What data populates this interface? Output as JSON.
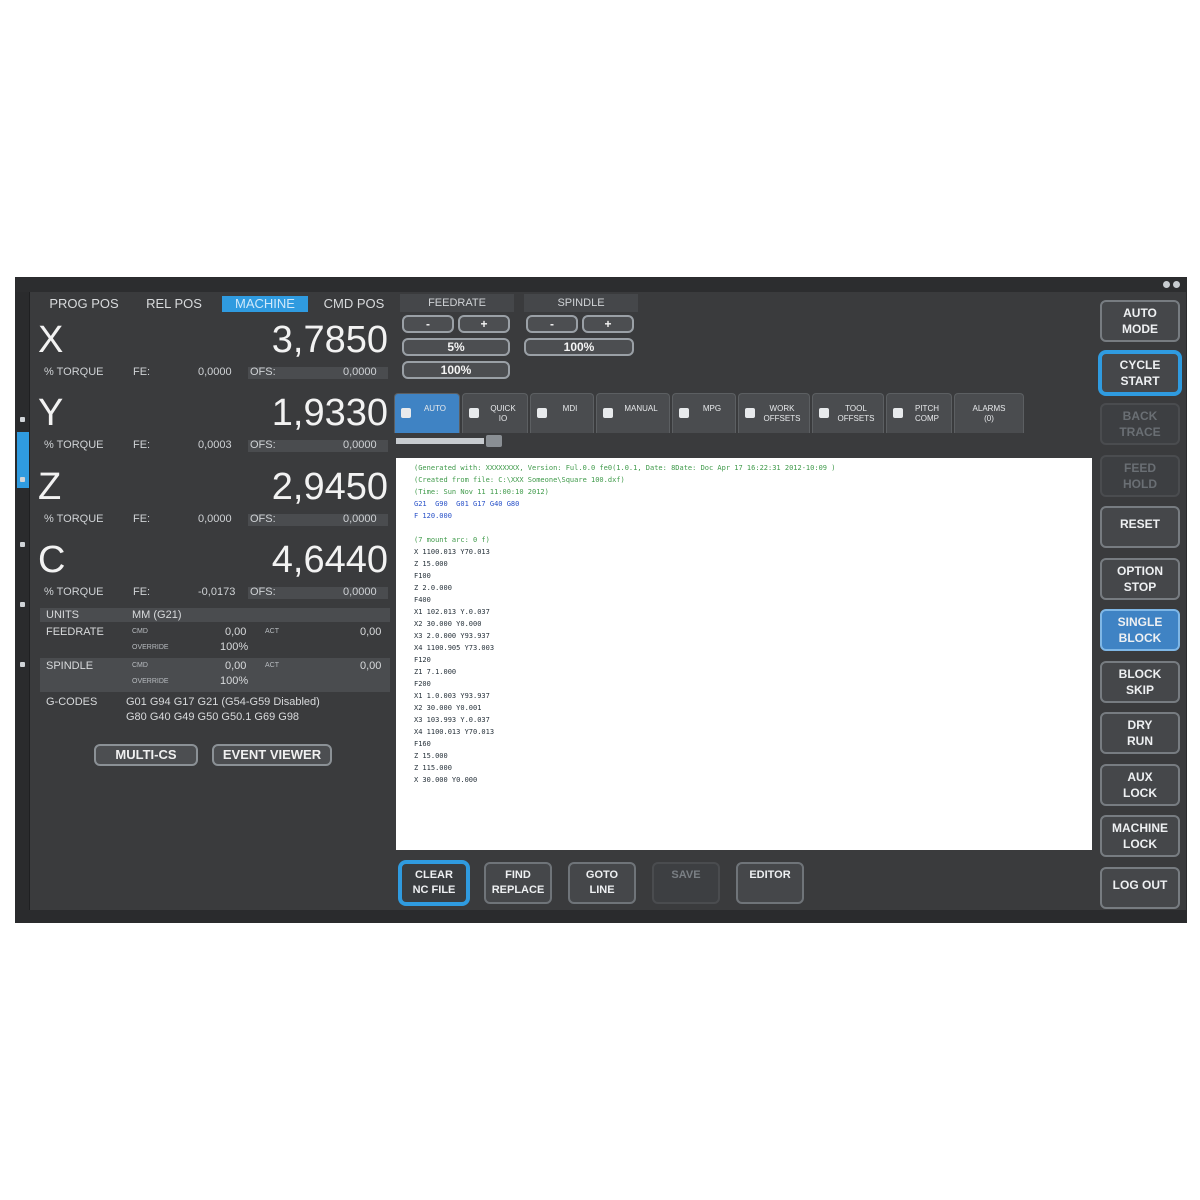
{
  "position": {
    "tabs": [
      "PROG POS",
      "REL POS",
      "MACHINE",
      "CMD POS"
    ],
    "active_tab": 2,
    "axes": [
      {
        "letter": "X",
        "value": "3,7850",
        "torque_label": "% TORQUE",
        "fe_label": "FE:",
        "fe_value": "0,0000",
        "ofs_label": "OFS:",
        "ofs_value": "0,0000"
      },
      {
        "letter": "Y",
        "value": "1,9330",
        "torque_label": "% TORQUE",
        "fe_label": "FE:",
        "fe_value": "0,0003",
        "ofs_label": "OFS:",
        "ofs_value": "0,0000"
      },
      {
        "letter": "Z",
        "value": "2,9450",
        "torque_label": "% TORQUE",
        "fe_label": "FE:",
        "fe_value": "0,0000",
        "ofs_label": "OFS:",
        "ofs_value": "0,0000"
      },
      {
        "letter": "C",
        "value": "4,6440",
        "torque_label": "% TORQUE",
        "fe_label": "FE:",
        "fe_value": "-0,0173",
        "ofs_label": "OFS:",
        "ofs_value": "0,0000"
      }
    ]
  },
  "info": {
    "units_label": "UNITS",
    "units_value": "MM (G21)",
    "feedrate_label": "FEEDRATE",
    "cmd_label": "CMD",
    "feed_cmd": "0,00",
    "act_label": "ACT",
    "feed_act": "0,00",
    "override_label": "OVERRIDE",
    "feed_override": "100%",
    "spindle_label": "SPINDLE",
    "spindle_cmd": "0,00",
    "spindle_act": "0,00",
    "spindle_override": "100%",
    "gcodes_label": "G-CODES",
    "gcodes_line1": "G01 G94 G17 G21 (G54-G59 Disabled)",
    "gcodes_line2": "G80 G40 G49 G50 G50.1 G69 G98"
  },
  "left_buttons": {
    "multi_cs": "MULTI-CS",
    "event_viewer": "EVENT VIEWER"
  },
  "overrides": {
    "feedrate_label": "FEEDRATE",
    "spindle_label": "SPINDLE",
    "minus": "-",
    "plus": "+",
    "feed_value": "5%",
    "feed_reset": "100%",
    "spindle_value": "100%"
  },
  "main_tabs": [
    {
      "label": "AUTO",
      "icon": "auto-icon"
    },
    {
      "label": "QUICK\nIO",
      "icon": "quick-io-icon"
    },
    {
      "label": "MDI",
      "icon": "mdi-icon"
    },
    {
      "label": "MANUAL",
      "icon": "manual-icon"
    },
    {
      "label": "MPG",
      "icon": "mpg-icon"
    },
    {
      "label": "WORK\nOFFSETS",
      "icon": "work-offsets-icon"
    },
    {
      "label": "TOOL\nOFFSETS",
      "icon": "tool-offsets-icon"
    },
    {
      "label": "PITCH\nCOMP",
      "icon": "pitch-comp-icon"
    },
    {
      "label": "ALARMS\n(0)",
      "icon": ""
    }
  ],
  "active_main_tab": 0,
  "nc_program": [
    {
      "t": "(Generated with: XXXXXXXX, Version: Ful.0.0 fe0(1.0.1, Date: 8Date: Doc Apr 17 16:22:31 2012-10:09 )",
      "c": true
    },
    {
      "t": "(Created from file: C:\\XXX Someone\\Square 100.dxf)",
      "c": true
    },
    {
      "t": "(Time: Sun Nov 11 11:00:10 2012)",
      "c": true
    },
    {
      "t": "G21  G90  G01 G17 G40 G80",
      "k": true
    },
    {
      "t": "F 120.000",
      "k": true
    },
    {
      "t": ""
    },
    {
      "t": "(7 mount arc: 0 f)",
      "c": true
    },
    {
      "t": "X 1100.013 Y70.013"
    },
    {
      "t": "Z 15.000"
    },
    {
      "t": "F100"
    },
    {
      "t": "Z 2.0.000"
    },
    {
      "t": "F400"
    },
    {
      "t": "X1 102.013 Y.0.037"
    },
    {
      "t": "X2 30.000 Y0.000"
    },
    {
      "t": "X3 2.0.000 Y93.937"
    },
    {
      "t": "X4 1100.905 Y73.003"
    },
    {
      "t": "F120"
    },
    {
      "t": "Z1 7.1.000"
    },
    {
      "t": "F200"
    },
    {
      "t": "X1 1.0.003 Y93.937"
    },
    {
      "t": "X2 30.000 Y0.001"
    },
    {
      "t": "X3 103.993 Y.0.037"
    },
    {
      "t": "X4 1100.013 Y70.013"
    },
    {
      "t": "F160"
    },
    {
      "t": "Z 15.000"
    },
    {
      "t": "Z 115.000"
    },
    {
      "t": "X 30.000 Y0.000"
    }
  ],
  "action_buttons": [
    {
      "label": "CLEAR\nNC FILE",
      "state": "active"
    },
    {
      "label": "FIND\nREPLACE",
      "state": "normal"
    },
    {
      "label": "GOTO\nLINE",
      "state": "normal"
    },
    {
      "label": "SAVE",
      "state": "disabled"
    },
    {
      "label": "EDITOR",
      "state": "normal"
    }
  ],
  "right_buttons": [
    {
      "label": "AUTO\nMODE",
      "state": "normal"
    },
    {
      "label": "CYCLE\nSTART",
      "state": "active"
    },
    {
      "label": "BACK\nTRACE",
      "state": "disabled"
    },
    {
      "label": "FEED\nHOLD",
      "state": "disabled"
    },
    {
      "label": "RESET",
      "state": "normal"
    },
    {
      "label": "OPTION\nSTOP",
      "state": "normal"
    },
    {
      "label": "SINGLE\nBLOCK",
      "state": "highlight"
    },
    {
      "label": "BLOCK\nSKIP",
      "state": "normal"
    },
    {
      "label": "DRY\nRUN",
      "state": "normal"
    },
    {
      "label": "AUX\nLOCK",
      "state": "normal"
    },
    {
      "label": "MACHINE\nLOCK",
      "state": "normal"
    },
    {
      "label": "LOG OUT",
      "state": "normal"
    }
  ],
  "colors": {
    "accent": "#2f9be0",
    "background": "#3a3b3d",
    "comment": "#3f9a4a",
    "keyword": "#2750c8"
  }
}
